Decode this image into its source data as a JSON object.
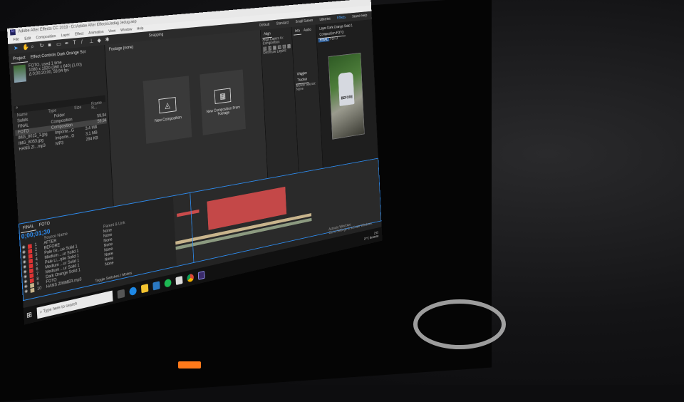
{
  "window": {
    "title": "Adobe After Effects CC 2019 - D:\\Adobe After Effects\\Jedag Jedug.aep"
  },
  "menu": [
    "File",
    "Edit",
    "Composition",
    "Layer",
    "Effect",
    "Animation",
    "View",
    "Window",
    "Help"
  ],
  "toolbar": {
    "snapping": "Snapping",
    "workspaces": [
      "Default",
      "Standard",
      "Small Screen",
      "Libraries"
    ],
    "active_ws": "Effects",
    "search": "Search Help"
  },
  "project": {
    "tab": "Project",
    "effect_tab": "Effect Controls Dark Orange Sol",
    "item_name": "FOTO",
    "used": ", used 1 time",
    "dims": "1080 x 1920 (360 x 640) (1,00)",
    "duration": "Δ 0;00;20;00, 59,94 fps",
    "search_icon": "search-icon",
    "headers": [
      "Name",
      "Type",
      "Size",
      "Frame R..."
    ],
    "items": [
      {
        "name": "Solids",
        "type": "Folder",
        "size": "",
        "fr": ""
      },
      {
        "name": "FINAL",
        "type": "Composition",
        "size": "",
        "fr": "59,94"
      },
      {
        "name": "FOTO",
        "type": "Composition",
        "size": "",
        "fr": "59,94"
      },
      {
        "name": "IMG_8015_1.jpg",
        "type": "Importe...G",
        "size": "3,4 MB",
        "fr": ""
      },
      {
        "name": "IMG_8053.jpg",
        "type": "Importe...G",
        "size": "3,1 MB",
        "fr": ""
      },
      {
        "name": "HANS ZI...mp3",
        "type": "MP3",
        "size": "294 KB",
        "fr": ""
      }
    ]
  },
  "viewer": {
    "tab": "Footage (none)",
    "new_comp": "New Composition",
    "new_from_footage": "New Composition From Footage"
  },
  "align": {
    "tab": "Align",
    "align_to_label": "Align Layers to:",
    "align_to": "Composition",
    "distribute": "Distribute Layers:"
  },
  "info": {
    "tab": "Info",
    "audio": "Audio"
  },
  "tracker": {
    "tabs": [
      "Wiggler",
      "Tracker"
    ],
    "motion_source": "Motion Source:",
    "source_value": "None"
  },
  "preview": {
    "layer_tab": "Layer Dark Orange Solid 1",
    "comp_tab": "Composition FOTO",
    "sub_tab": "FINAL",
    "sub_tab2": "FOTO",
    "photo_text": "BEFORE"
  },
  "timeline": {
    "tabs": [
      "FINAL",
      "FOTO"
    ],
    "timecode": "0;00;01;30",
    "header_source": "Source Name",
    "header_parent": "Parent & Link",
    "layers": [
      {
        "n": "1",
        "name": "AFTER",
        "parent": "None"
      },
      {
        "n": "2",
        "name": "BEFORE",
        "parent": "None"
      },
      {
        "n": "3",
        "name": "Pale Gr...ue Solid 1",
        "parent": "None"
      },
      {
        "n": "4",
        "name": "Medium ...ur Solid 1",
        "parent": "None"
      },
      {
        "n": "5",
        "name": "Pale Li...rple Solid 1",
        "parent": "None"
      },
      {
        "n": "6",
        "name": "Medium ...ur Solid 1",
        "parent": "None"
      },
      {
        "n": "7",
        "name": "Medium ...ur Solid 1",
        "parent": "None"
      },
      {
        "n": "8",
        "name": "Dark Orange Solid 1",
        "parent": "None"
      },
      {
        "n": "9",
        "name": "FOTO",
        "parent": ""
      },
      {
        "n": "10",
        "name": "HANS ZIMMER.mp3",
        "parent": ""
      }
    ],
    "toggle_label": "Toggle Switches / Modes"
  },
  "taskbar": {
    "search": "Type here to search",
    "time": "2:55",
    "tray": "27°C Berawan",
    "activate_title": "Activate Windows",
    "activate_sub": "Go to Settings to activate Windows."
  },
  "colors": {
    "accent": "#2d8cf0",
    "layer_red": "#c94b4b",
    "label_red": "#d33333"
  }
}
